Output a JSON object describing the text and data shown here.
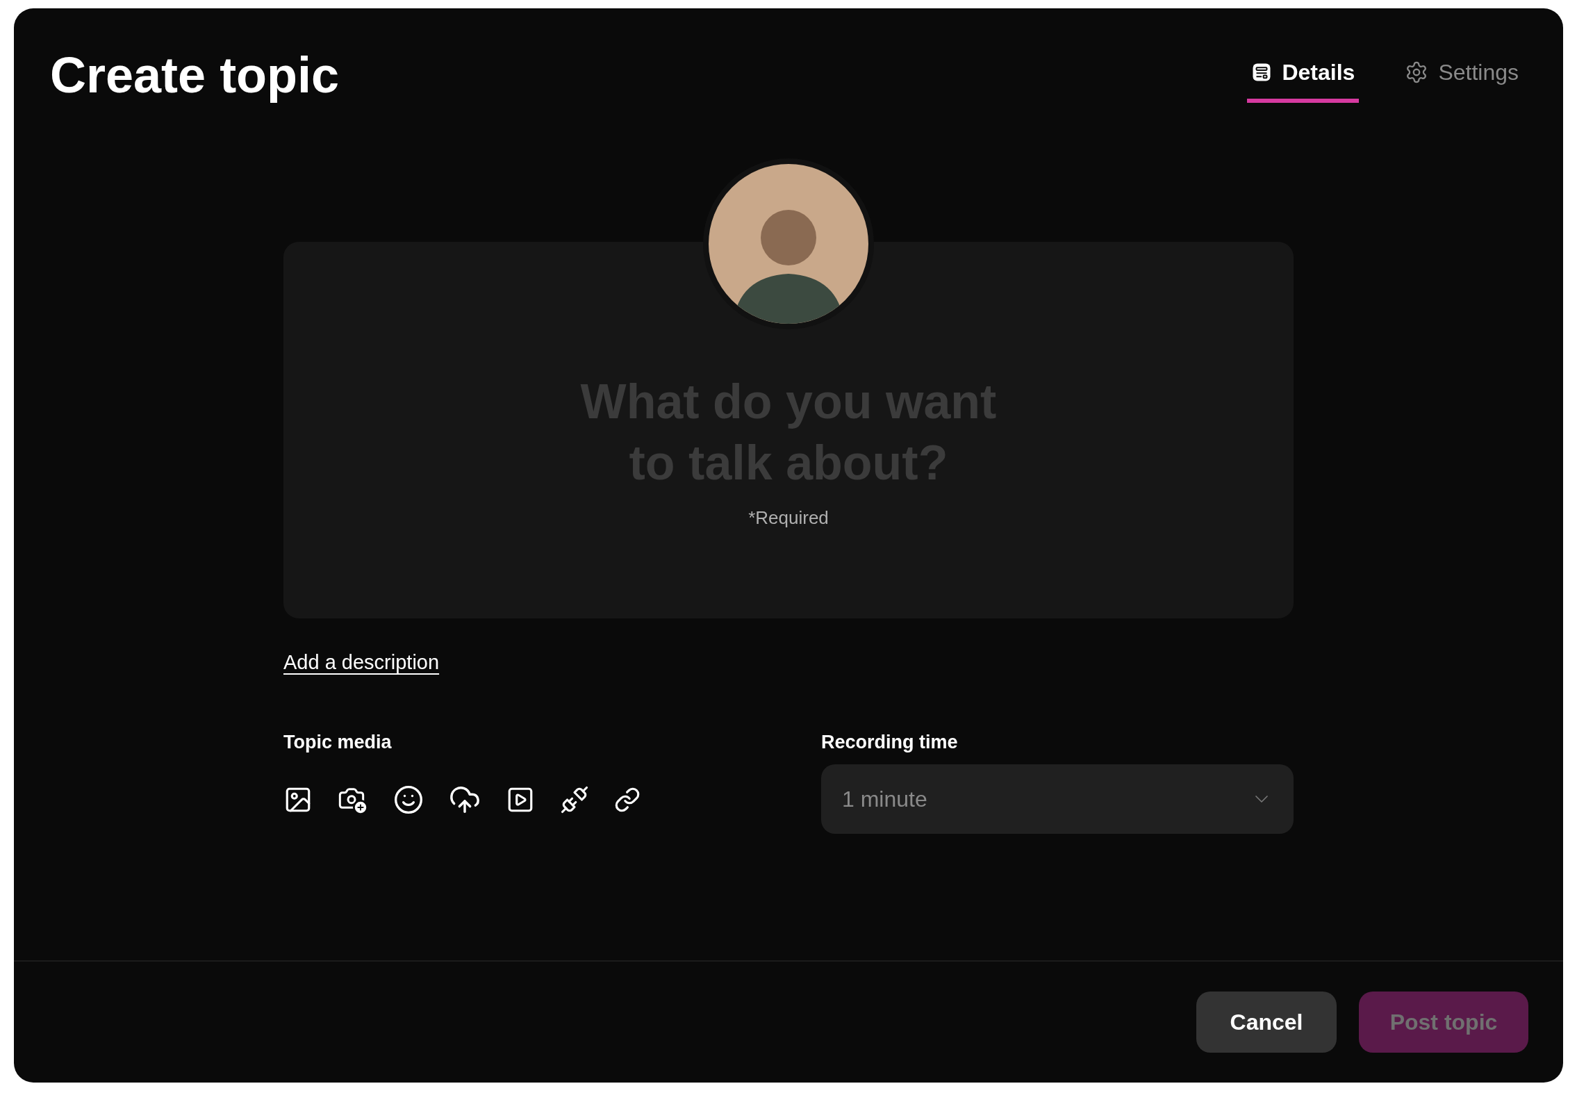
{
  "title": "Create topic",
  "tabs": [
    {
      "label": "Details",
      "selected": true
    },
    {
      "label": "Settings",
      "selected": false
    }
  ],
  "topic_field": {
    "placeholder": "What do you want to talk about?",
    "note": "*Required"
  },
  "description_link": "Add a description",
  "topic_media": {
    "label": "Topic media"
  },
  "recording_time": {
    "label": "Recording time",
    "value": "1 minute"
  },
  "buttons": [
    {
      "label": "Cancel",
      "kind": "secondary",
      "disabled": false
    },
    {
      "label": "Post topic",
      "kind": "primary",
      "disabled": true
    }
  ]
}
